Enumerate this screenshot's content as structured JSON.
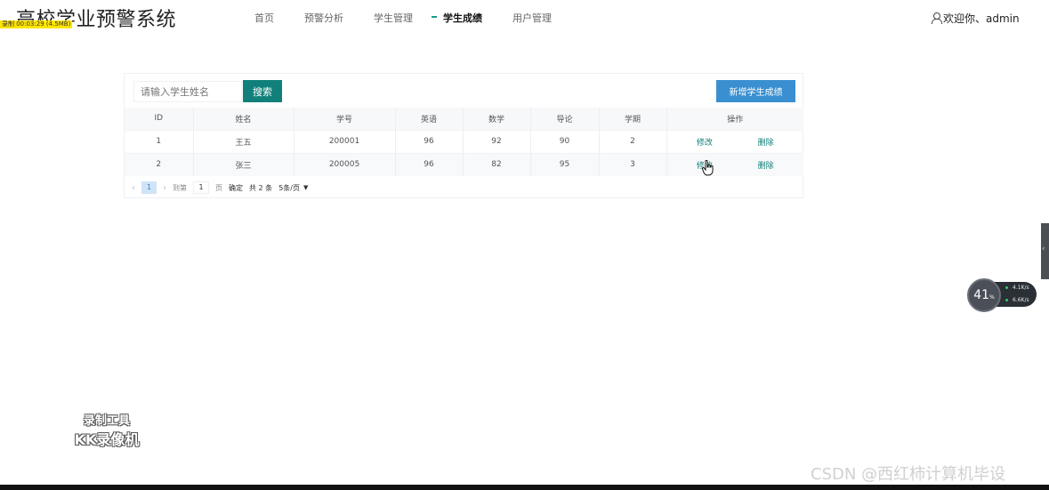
{
  "header": {
    "brand": "高校学业预警系统",
    "watermark": "录制 00:03:29 (4.5MB)",
    "nav": [
      "首页",
      "预警分析",
      "学生管理",
      "学生成绩",
      "用户管理"
    ],
    "active_nav": "学生成绩",
    "user_text": "欢迎你、admin"
  },
  "toolbar": {
    "search_placeholder": "请输入学生姓名",
    "search_label": "搜索",
    "add_label": "新增学生成绩"
  },
  "table": {
    "columns": [
      "ID",
      "姓名",
      "学号",
      "英语",
      "数学",
      "导论",
      "学期",
      "操作"
    ],
    "rows": [
      {
        "id": "1",
        "name": "王五",
        "number": "200001",
        "english": "96",
        "math": "92",
        "intro": "90",
        "term": "2",
        "edit": "修改",
        "delete": "删除"
      },
      {
        "id": "2",
        "name": "张三",
        "number": "200005",
        "english": "96",
        "math": "82",
        "intro": "95",
        "term": "3",
        "edit": "修改",
        "delete": "删除"
      }
    ]
  },
  "pager": {
    "prev": "‹",
    "page": "1",
    "next": "›",
    "goto_label": "到第",
    "goto_value": "1",
    "page_suffix": "页",
    "confirm": "确定",
    "total": "共 2 条",
    "page_size": "5条/页"
  },
  "overlay": {
    "net_percent": "41",
    "net_percent_unit": "%",
    "upload": "4.1K/s",
    "download": "6.6K/s",
    "recorder_line1": "录制工具",
    "recorder_line2": "KK录像机",
    "csdn": "CSDN @西红柿计算机毕设"
  },
  "colors": {
    "primary": "#11807a",
    "add_button": "#3a8fd0",
    "active_page": "#cfe4f7"
  }
}
